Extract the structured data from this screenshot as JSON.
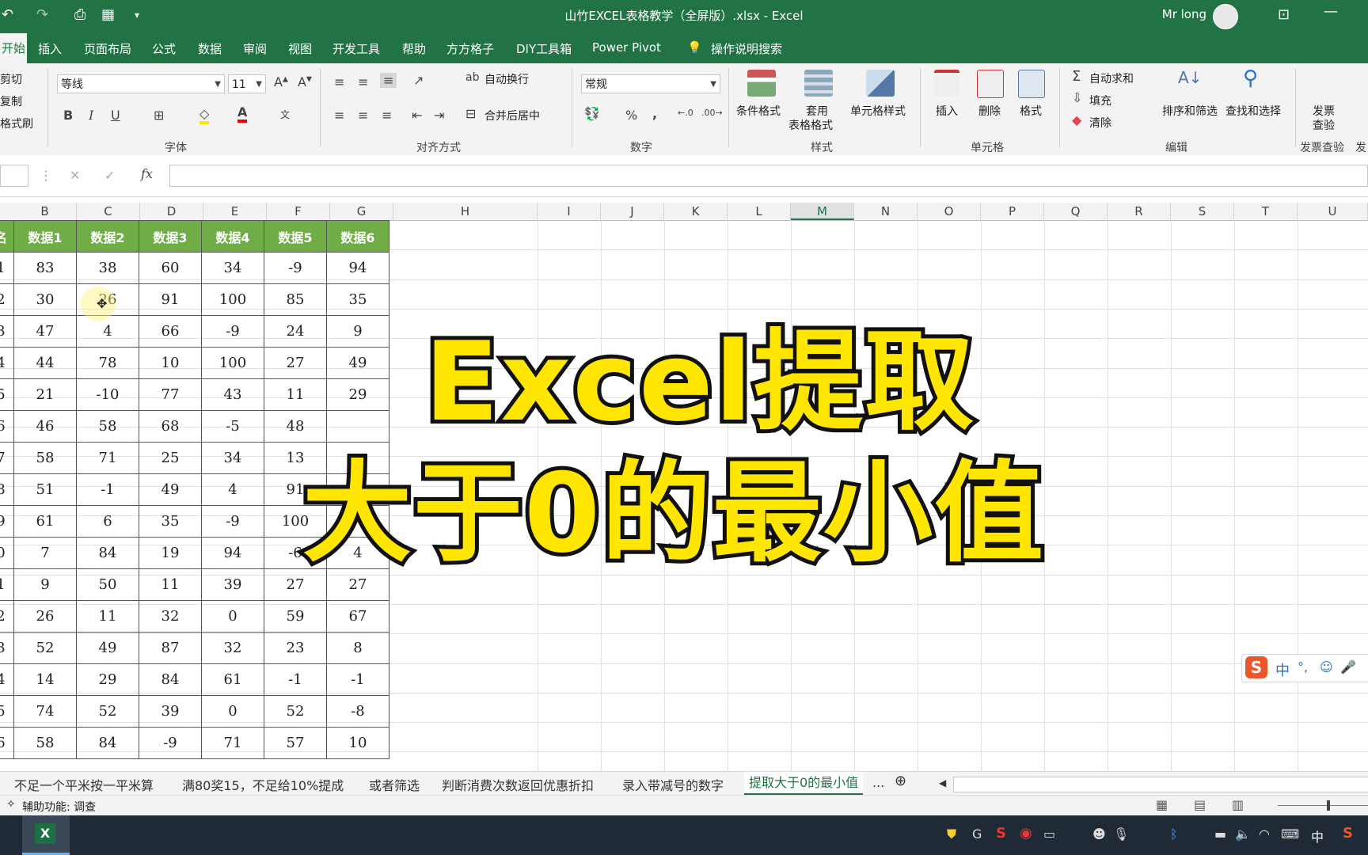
{
  "window": {
    "title": "山竹EXCEL表格教学（全屏版）.xlsx  -  Excel",
    "user": "Mr long"
  },
  "tabs": [
    "开始",
    "插入",
    "页面布局",
    "公式",
    "数据",
    "审阅",
    "视图",
    "开发工具",
    "帮助",
    "方方格子",
    "DIY工具箱",
    "Power Pivot"
  ],
  "tell_me": "操作说明搜索",
  "ribbon": {
    "clipboard": [
      "剪切",
      "复制",
      "格式刷"
    ],
    "font_name": "等线",
    "font_size": "11",
    "group_font": "字体",
    "group_align": "对齐方式",
    "wrap_text": "自动换行",
    "merge_center": "合并后居中",
    "number_format": "常规",
    "group_number": "数字",
    "cond_format": "条件格式",
    "table_format_1": "套用",
    "table_format_2": "表格格式",
    "cell_styles": "单元格样式",
    "group_styles": "样式",
    "insert": "插入",
    "delete": "删除",
    "format": "格式",
    "group_cells": "单元格",
    "autosum": "自动求和",
    "fill": "填充",
    "clear": "清除",
    "sort_filter": "排序和筛选",
    "find_select": "查找和选择",
    "group_editing": "编辑",
    "invoice_1": "发票",
    "invoice_2": "查验",
    "group_invoice": "发票查验",
    "group_cut": "发",
    "bold": "B",
    "italic": "I",
    "underline": "U",
    "font_color": "A",
    "pct": "%",
    "comma": ","
  },
  "formula_bar": {
    "fx": "fx",
    "cancel": "✕",
    "enter": "✓"
  },
  "columns": [
    "B",
    "C",
    "D",
    "E",
    "F",
    "G",
    "H",
    "I",
    "J",
    "K",
    "L",
    "M",
    "N",
    "O",
    "P",
    "Q",
    "R",
    "S",
    "T",
    "U"
  ],
  "table": {
    "headers": [
      "名",
      "数据1",
      "数据2",
      "数据3",
      "数据4",
      "数据5",
      "数据6"
    ],
    "rows": [
      [
        "1",
        "83",
        "38",
        "60",
        "34",
        "-9",
        "94"
      ],
      [
        "2",
        "30",
        "26",
        "91",
        "100",
        "85",
        "35"
      ],
      [
        "3",
        "47",
        "4",
        "66",
        "-9",
        "24",
        "9"
      ],
      [
        "4",
        "44",
        "78",
        "10",
        "100",
        "27",
        "49"
      ],
      [
        "5",
        "21",
        "-10",
        "77",
        "43",
        "11",
        "29"
      ],
      [
        "6",
        "46",
        "58",
        "68",
        "-5",
        "48",
        ""
      ],
      [
        "7",
        "58",
        "71",
        "25",
        "34",
        "13",
        ""
      ],
      [
        "8",
        "51",
        "-1",
        "49",
        "4",
        "91",
        ""
      ],
      [
        "9",
        "61",
        "6",
        "35",
        "-9",
        "100",
        "51"
      ],
      [
        "0",
        "7",
        "84",
        "19",
        "94",
        "-6",
        "4"
      ],
      [
        "1",
        "9",
        "50",
        "11",
        "39",
        "27",
        "27"
      ],
      [
        "2",
        "26",
        "11",
        "32",
        "0",
        "59",
        "67"
      ],
      [
        "3",
        "52",
        "49",
        "87",
        "32",
        "23",
        "8"
      ],
      [
        "4",
        "14",
        "29",
        "84",
        "61",
        "-1",
        "-1"
      ],
      [
        "5",
        "74",
        "52",
        "39",
        "0",
        "52",
        "-8"
      ],
      [
        "6",
        "58",
        "84",
        "-9",
        "71",
        "57",
        "10"
      ]
    ]
  },
  "overlay": {
    "line1": "Excel提取",
    "line2": "大于0的最小值"
  },
  "sheet_tabs": [
    "不足一个平米按一平米算",
    "满80奖15，不足给10%提成",
    "或者筛选",
    "判断消费次数返回优惠折扣",
    "录入带减号的数字",
    "提取大于0的最小值"
  ],
  "sheet_more": "...",
  "status": "辅助功能: 调查",
  "ime": "中",
  "taskbar_ime": "中",
  "colors": {
    "excel_green": "#217346",
    "header_green": "#70ad47",
    "overlay_yellow": "#ffe600"
  }
}
